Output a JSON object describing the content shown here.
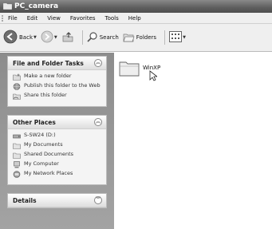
{
  "window": {
    "title": "PC_camera"
  },
  "menu": [
    "File",
    "Edit",
    "View",
    "Favorites",
    "Tools",
    "Help"
  ],
  "toolbar": {
    "back_label": "Back",
    "search_label": "Search",
    "folders_label": "Folders"
  },
  "left_panel": {
    "file_tasks": {
      "title": "File and Folder Tasks",
      "items": [
        "Make a new folder",
        "Publish this folder to the Web",
        "Share this folder"
      ]
    },
    "other_places": {
      "title": "Other Places",
      "items": [
        "S-SW24 (D:)",
        "My Documents",
        "Shared Documents",
        "My Computer",
        "My Network Places"
      ]
    },
    "details": {
      "title": "Details"
    }
  },
  "content": {
    "folders": [
      {
        "name": "WinXP"
      }
    ]
  },
  "colors": {
    "titlebar": "#5e5e5e",
    "task_pane": "#999999"
  }
}
